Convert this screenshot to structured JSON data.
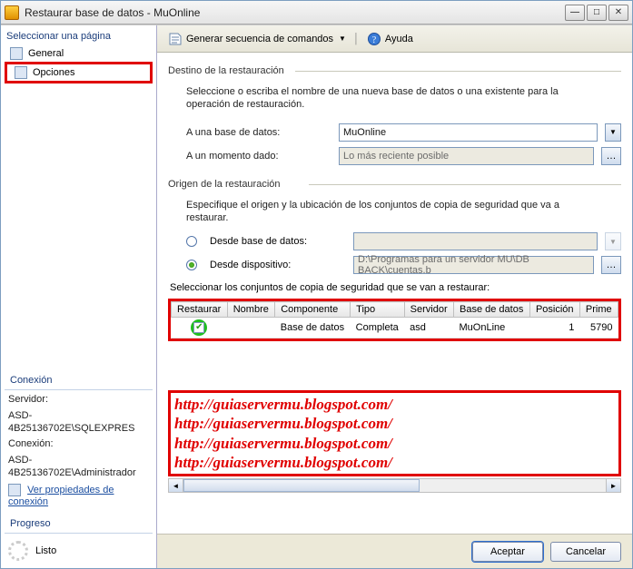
{
  "window": {
    "title": "Restaurar base de datos - MuOnline"
  },
  "sidebar": {
    "header": "Seleccionar una página",
    "items": [
      {
        "label": "General"
      },
      {
        "label": "Opciones"
      }
    ],
    "connection_title": "Conexión",
    "server_label": "Servidor:",
    "server_value": "ASD-4B25136702E\\SQLEXPRES",
    "conn_label": "Conexión:",
    "conn_value": "ASD-4B25136702E\\Administrador",
    "props_link": "Ver propiedades de conexión",
    "progress_title": "Progreso",
    "progress_status": "Listo"
  },
  "toolbar": {
    "script_label": "Generar secuencia de comandos",
    "help_label": "Ayuda"
  },
  "destination": {
    "title": "Destino de la restauración",
    "desc": "Seleccione o escriba el nombre de una nueva base de datos o una existente para la operación de restauración.",
    "db_label": "A una base de datos:",
    "db_value": "MuOnline",
    "time_label": "A un momento dado:",
    "time_value": "Lo más reciente posible"
  },
  "source": {
    "title": "Origen de la restauración",
    "desc": "Especifique el origen y la ubicación de los conjuntos de copia de seguridad que va a restaurar.",
    "radio_db": "Desde base de datos:",
    "radio_device": "Desde dispositivo:",
    "device_value": "D:\\Programas para un servidor MU\\DB BACK\\cuentas.b",
    "select_label": "Seleccionar los conjuntos de copia de seguridad que se van a restaurar:",
    "columns": [
      "Restaurar",
      "Nombre",
      "Componente",
      "Tipo",
      "Servidor",
      "Base de datos",
      "Posición",
      "Prime"
    ],
    "rows": [
      {
        "restore": true,
        "nombre": "",
        "componente": "Base de datos",
        "tipo": "Completa",
        "servidor": "asd",
        "bd": "MuOnLine",
        "posicion": "1",
        "prime": "5790"
      }
    ]
  },
  "watermark": {
    "l1": "http://guiaservermu.blogspot.com/",
    "l2": "http://guiaservermu.blogspot.com/",
    "l3": "http://guiaservermu.blogspot.com/",
    "l4": "http://guiaservermu.blogspot.com/"
  },
  "footer": {
    "ok": "Aceptar",
    "cancel": "Cancelar"
  }
}
